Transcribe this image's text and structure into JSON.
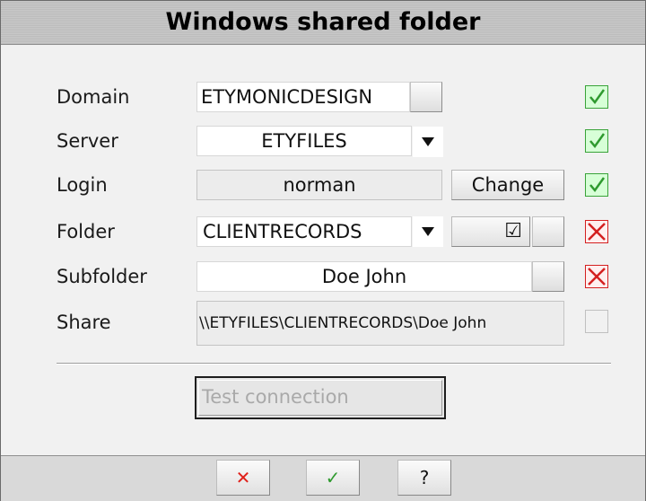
{
  "title": "Windows shared folder",
  "rows": {
    "domain": {
      "label": "Domain",
      "value": "ETYMONICDESIGN"
    },
    "server": {
      "label": "Server",
      "value": "ETYFILES"
    },
    "login": {
      "label": "Login",
      "value": "norman",
      "button": "Change"
    },
    "folder": {
      "label": "Folder",
      "value": "CLIENTRECORDS",
      "checkbox": "☑"
    },
    "subfolder": {
      "label": "Subfolder",
      "value": "Doe John"
    },
    "share": {
      "label": "Share",
      "value": "\\\\ETYFILES\\CLIENTRECORDS\\Doe John"
    }
  },
  "status": {
    "domain": "ok",
    "server": "ok",
    "login": "ok",
    "folder": "error",
    "subfolder": "error",
    "share": "empty"
  },
  "test_button": "Test connection",
  "footer": {
    "cancel": "✕",
    "ok": "✓",
    "help": "?"
  },
  "colors": {
    "ok": "#39a339",
    "error": "#d42020",
    "cancel_icon": "#e0201a",
    "ok_icon": "#2f9a2f"
  }
}
